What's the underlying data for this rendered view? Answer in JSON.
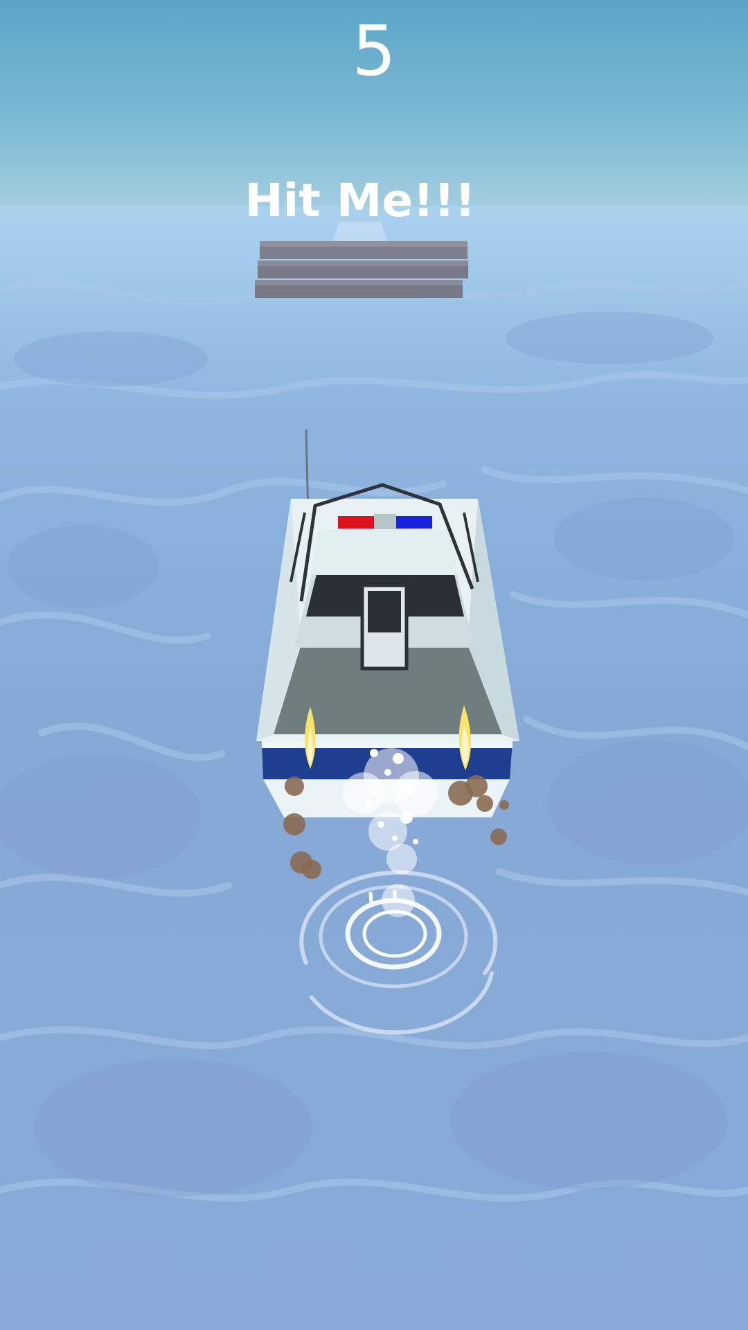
{
  "hud": {
    "score": "5"
  },
  "target": {
    "label": "Hit Me!!!"
  },
  "colors": {
    "sky": "#6fb1cd",
    "sea": "#86a9d6",
    "target_crate": "#7a7c8a",
    "boat_stripe": "#1e3f8f",
    "light_red": "#e0101f",
    "light_blue": "#1a22e0"
  }
}
